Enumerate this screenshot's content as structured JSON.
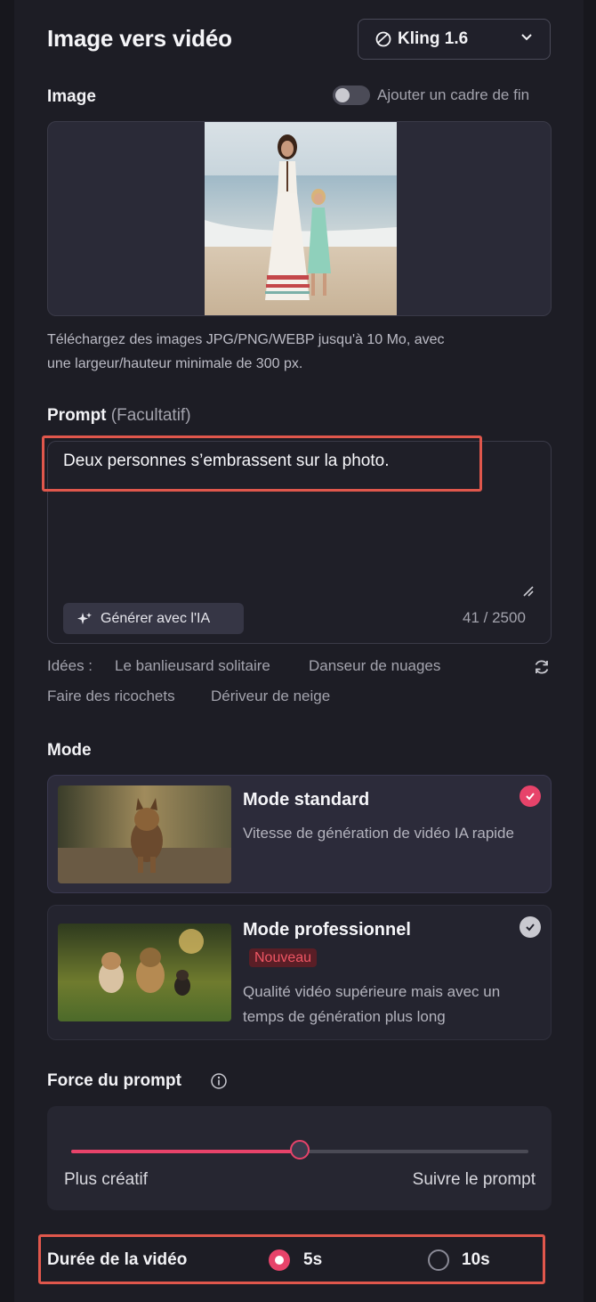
{
  "header": {
    "title": "Image vers vidéo",
    "model": "Kling 1.6"
  },
  "image_section": {
    "label": "Image",
    "end_frame_toggle_label": "Ajouter un cadre de fin",
    "hint_line1": "Téléchargez des images JPG/PNG/WEBP jusqu'à 10 Mo, avec",
    "hint_line2": "une largeur/hauteur minimale de 300 px."
  },
  "prompt": {
    "label": "Prompt",
    "optional": "(Facultatif)",
    "value": "Deux personnes s’embrassent sur la photo.",
    "generate_label": "Générer avec l'IA",
    "counter": "41 / 2500"
  },
  "ideas": {
    "label": "Idées :",
    "items": [
      "Le banlieusard solitaire",
      "Danseur de nuages",
      "Faire des ricochets",
      "Dériveur de neige"
    ]
  },
  "mode": {
    "label": "Mode",
    "options": [
      {
        "title": "Mode standard",
        "desc": "Vitesse de génération de vidéo IA rapide",
        "selected": true
      },
      {
        "title": "Mode professionnel",
        "badge": "Nouveau",
        "desc": "Qualité vidéo supérieure mais avec un temps de génération plus long",
        "selected": false
      }
    ]
  },
  "prompt_strength": {
    "label": "Force du prompt",
    "left_label": "Plus créatif",
    "right_label": "Suivre le prompt",
    "value": 0.5
  },
  "duration": {
    "label": "Durée de la vidéo",
    "options": [
      {
        "label": "5s",
        "selected": true
      },
      {
        "label": "10s",
        "selected": false
      }
    ]
  },
  "colors": {
    "accent": "#e7436a",
    "highlight_outline": "#e0574c",
    "background": "#1d1d25"
  }
}
